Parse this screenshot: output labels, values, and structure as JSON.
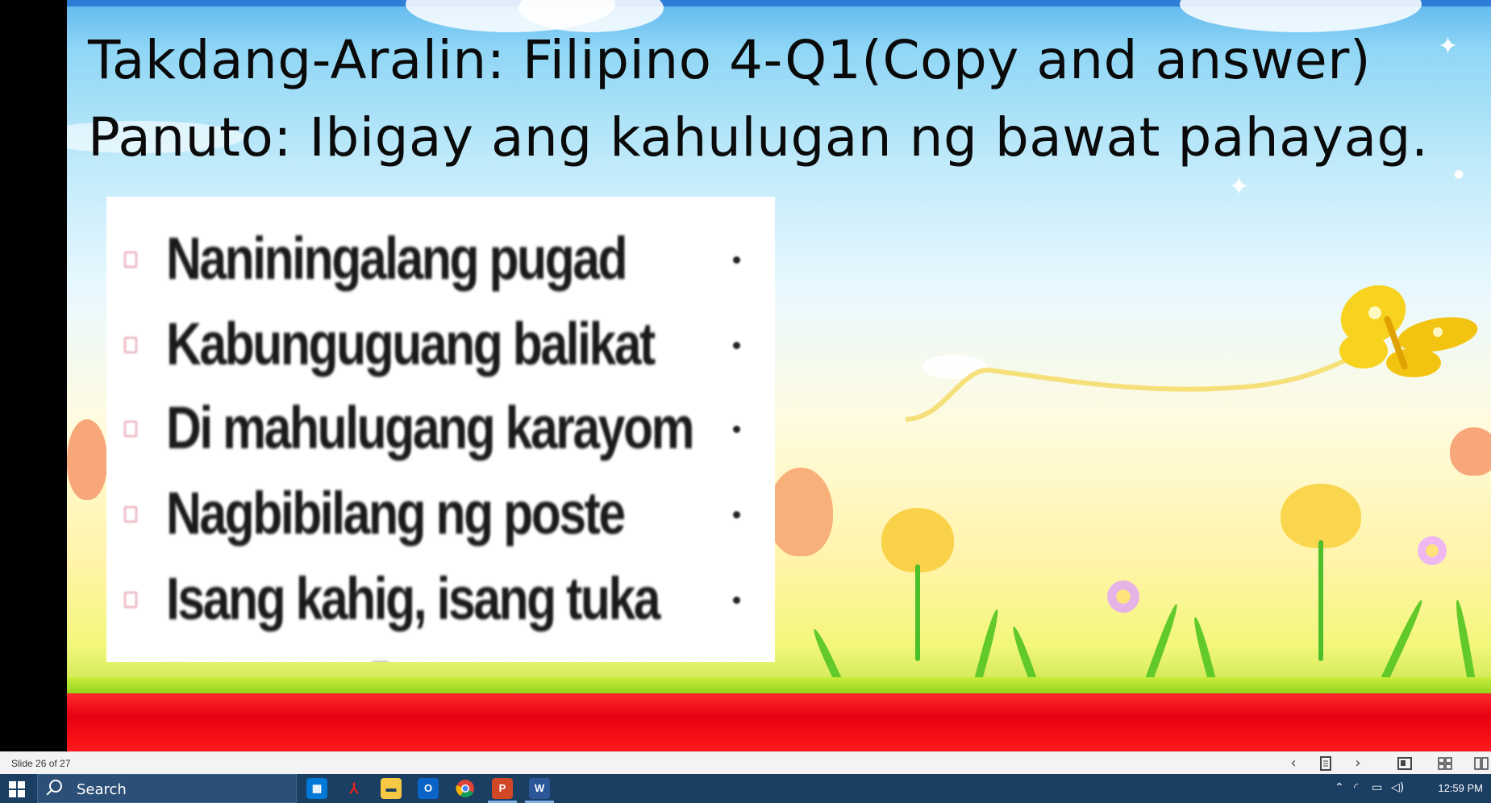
{
  "slide": {
    "title_line1": "Takdang-Aralin: Filipino 4-Q1(Copy and answer)",
    "title_line2": "Panuto: Ibigay ang kahulugan ng bawat pahayag.",
    "items": [
      "Naniningalang pugad",
      "Kabunguguang balikat",
      "Di mahulugang karayom",
      "Nagbibilang ng poste",
      "Isang kahig, isang tuka"
    ]
  },
  "statusbar": {
    "slide_indicator": "Slide 26 of 27",
    "prev_icon": "chevron-left-icon",
    "next_icon": "chevron-right-icon"
  },
  "taskbar": {
    "search_placeholder": "Search",
    "apps": [
      "store-icon",
      "acrobat-icon",
      "file-explorer-icon",
      "outlook-icon",
      "chrome-icon",
      "powerpoint-icon",
      "word-icon"
    ],
    "clock": "12:59 PM"
  }
}
